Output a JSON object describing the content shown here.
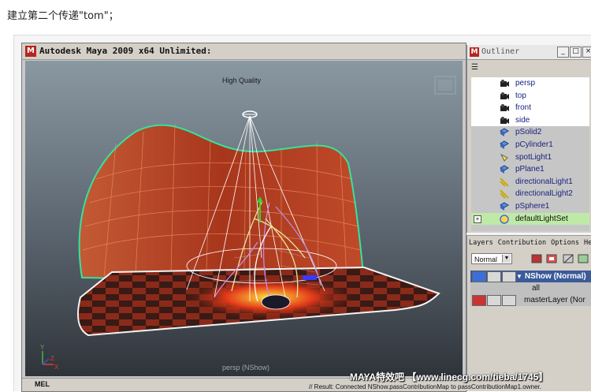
{
  "caption": "建立第二个传递\"tom\"；",
  "maya": {
    "title": "Autodesk Maya 2009 x64 Unlimited:",
    "viewport": {
      "quality_label": "High Quality",
      "camera_label": "persp (NShow)",
      "axis_y": "Y",
      "axis_x": "X",
      "axis_z": "Z",
      "colors": {
        "bg_top": "#7a8a95",
        "bg_bottom": "#3a3f46",
        "wall": "#b8452a",
        "wire": "#3fe0a0"
      }
    },
    "statusbar": {
      "mel_label": "MEL"
    }
  },
  "result_text": "// Result: Connected NShow.passContributionMap to passContributionMap1.owner.",
  "watermark": "MAYA特效吧 【www.linecg.com/tieba/1745】",
  "outliner": {
    "title": "Outliner",
    "buttons": {
      "minimize": "_",
      "maximize": "□",
      "close": "×"
    },
    "filter_icon": "filter-icon",
    "items": [
      {
        "label": "persp",
        "icon": "camera-icon",
        "kind": "cam"
      },
      {
        "label": "top",
        "icon": "camera-icon",
        "kind": "cam"
      },
      {
        "label": "front",
        "icon": "camera-icon",
        "kind": "cam"
      },
      {
        "label": "side",
        "icon": "camera-icon",
        "kind": "cam"
      },
      {
        "label": "pSolid2",
        "icon": "mesh-icon",
        "kind": "obj"
      },
      {
        "label": "pCylinder1",
        "icon": "mesh-icon",
        "kind": "obj"
      },
      {
        "label": "spotLight1",
        "icon": "spotlight-icon",
        "kind": "obj"
      },
      {
        "label": "pPlane1",
        "icon": "mesh-icon",
        "kind": "obj"
      },
      {
        "label": "directionalLight1",
        "icon": "directional-light-icon",
        "kind": "obj"
      },
      {
        "label": "directionalLight2",
        "icon": "directional-light-icon",
        "kind": "obj"
      },
      {
        "label": "pSphere1",
        "icon": "mesh-icon",
        "kind": "obj"
      },
      {
        "label": "defaultLightSet",
        "icon": "light-set-icon",
        "kind": "sel",
        "expand": "+"
      }
    ]
  },
  "layers": {
    "menu": [
      "Layers",
      "Contribution",
      "Options",
      "He"
    ],
    "mode": "Normal",
    "rows": [
      {
        "label": "NShow (Normal)",
        "kind": "active",
        "prefix": "▼"
      },
      {
        "label": "all",
        "kind": "sub",
        "prefix": ""
      },
      {
        "label": "masterLayer (Nor",
        "kind": "master",
        "prefix": ""
      }
    ]
  }
}
